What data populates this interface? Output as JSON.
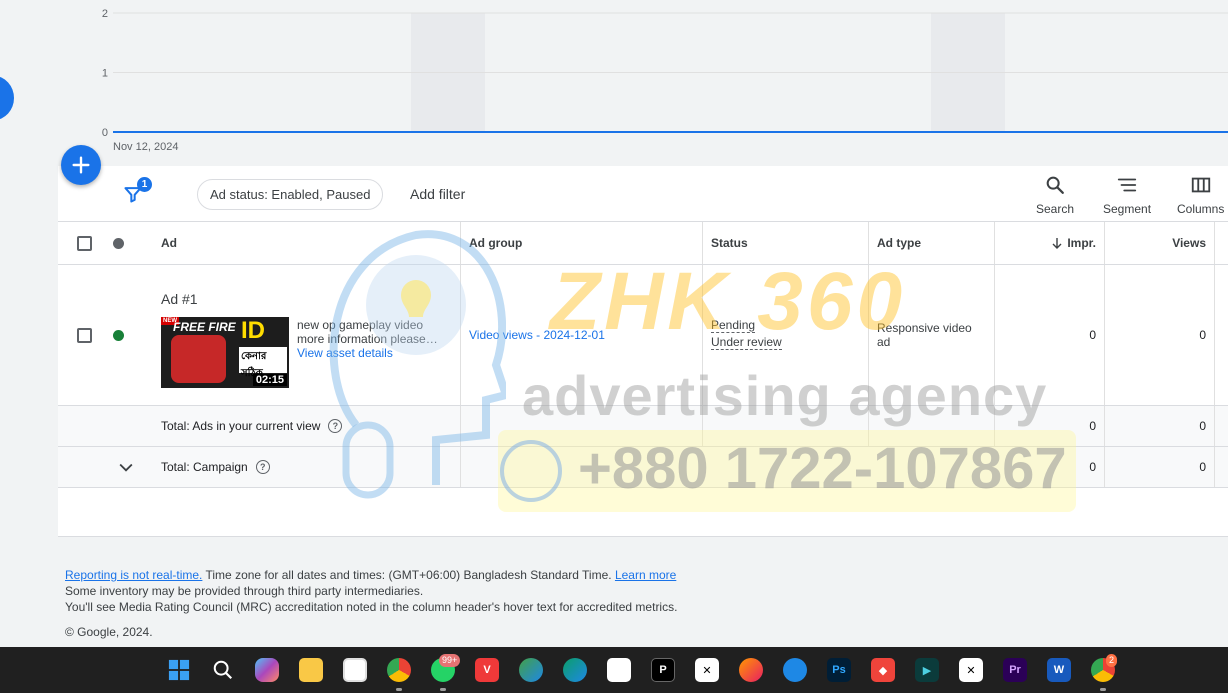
{
  "chart_data": {
    "type": "line",
    "x": [
      "Nov 12, 2024"
    ],
    "xlabel_visible": [
      "Nov 12, 2024"
    ],
    "y_ticks": [
      "0",
      "1",
      "2"
    ],
    "ylim": [
      0,
      2
    ],
    "series": [
      {
        "values": [
          0,
          0,
          0,
          0,
          0,
          0,
          0,
          0,
          0,
          0,
          0,
          0,
          0,
          0,
          0,
          0
        ]
      }
    ],
    "grid": true,
    "line_color": "#1a73e8",
    "shaded_band_color": "#e8eaed"
  },
  "toolbar": {
    "filter_count": "1",
    "chip_label": "Ad status: Enabled, Paused",
    "add_filter": "Add filter",
    "search": "Search",
    "segment": "Segment",
    "columns": "Columns"
  },
  "table": {
    "headers": {
      "ad": "Ad",
      "ad_group": "Ad group",
      "status": "Status",
      "ad_type": "Ad type",
      "impr": "Impr.",
      "views": "Views"
    },
    "ad_row": {
      "name": "Ad #1",
      "desc1": "new op gameplay video",
      "desc2": "more information please…",
      "asset_link": "View asset details",
      "thumb_brand": "FREE FIRE",
      "thumb_id": "ID",
      "thumb_bn": "কেনার সঠিক",
      "thumb_duration": "02:15",
      "thumb_new": "NEW",
      "ad_group": "Video views - 2024-12-01",
      "status1": "Pending",
      "status2": "Under review",
      "ad_type": "Responsive video ad",
      "impr": "0",
      "views": "0"
    },
    "total_view": {
      "label": "Total: Ads in your current view",
      "impr": "0",
      "views": "0"
    },
    "total_campaign": {
      "label": "Total: Campaign",
      "impr": "0",
      "views": "0"
    }
  },
  "watermark": {
    "brand": "ZHK 360",
    "agency": "advertising agency",
    "phone": "+880 1722-107867"
  },
  "footer": {
    "link1": "Reporting is not real-time.",
    "line1": " Time zone for all dates and times: (GMT+06:00) Bangladesh Standard Time. ",
    "link2": "Learn more",
    "line2": "Some inventory may be provided through third party intermediaries.",
    "line3": "You'll see Media Rating Council (MRC) accreditation noted in the column header's hover text for accredited metrics.",
    "copyright": "© Google, 2024."
  },
  "taskbar": {
    "badge_whatsapp": "99+",
    "badge_chrome": "2",
    "icons": [
      "windows-start-icon",
      "search-icon",
      "copilot-icon",
      "file-explorer-icon",
      "snipping-tool-icon",
      "chrome-icon",
      "whatsapp-icon",
      "vivaldi-icon",
      "edge-beta-icon",
      "edge-icon",
      "microsoft-store-icon",
      "pixel-editor-icon",
      "capcut-icon",
      "firefox-icon",
      "vpn-icon",
      "photoshop-icon",
      "anydesk-icon",
      "filmora-icon",
      "capcut-alt-icon",
      "premiere-icon",
      "word-icon",
      "chrome-profile-icon"
    ]
  }
}
